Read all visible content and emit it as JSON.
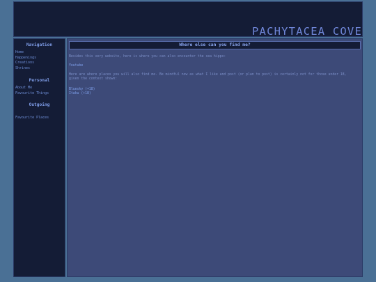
{
  "header": {
    "site_title": "PACHYTACEA COVE"
  },
  "sidebar": {
    "navigation": {
      "heading": "Navigation",
      "items": [
        "Home",
        "Happenings",
        "Creations",
        "Shrines"
      ]
    },
    "personal": {
      "heading": "Personal",
      "items": [
        "About Me",
        "Favourite Things"
      ]
    },
    "outgoing": {
      "heading": "Outgoing",
      "items": [
        "Favourite Places"
      ]
    }
  },
  "main": {
    "title": "Where else can you find me?",
    "intro": "Besides this very website, here is where you can also encounter the sea hippo:",
    "links1": [
      "Youtube"
    ],
    "note": "Here are where places you will also find me. Be mindful now as what I like and post (or plan to post) is certainly not for those under 18, given the context shown:",
    "links2": [
      "Bluesky (+18)",
      "Itaku (+18)"
    ]
  }
}
